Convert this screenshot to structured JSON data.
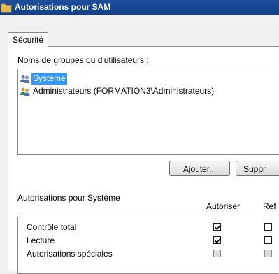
{
  "window": {
    "title": "Autorisations pour SAM",
    "icon": "folder-icon"
  },
  "tabs": [
    {
      "label": "Sécurité",
      "active": true
    }
  ],
  "groups": {
    "label": "Noms de groupes ou d'utilisateurs :",
    "items": [
      {
        "label": "Système",
        "icon": "users-icon",
        "selected": true
      },
      {
        "label": "Administrateurs (FORMATION3\\Administrateurs)",
        "icon": "users-icon",
        "selected": false
      }
    ]
  },
  "buttons": {
    "add": "Ajouter...",
    "remove": "Suppr"
  },
  "permissions": {
    "label": "Autorisations pour Système",
    "col_allow": "Autoriser",
    "col_deny": "Ref",
    "rows": [
      {
        "name": "Contrôle total",
        "allow": true,
        "deny": false,
        "allow_disabled": false,
        "deny_disabled": false
      },
      {
        "name": "Lecture",
        "allow": true,
        "deny": false,
        "allow_disabled": false,
        "deny_disabled": false
      },
      {
        "name": "Autorisations spéciales",
        "allow": false,
        "deny": false,
        "allow_disabled": true,
        "deny_disabled": true
      }
    ]
  },
  "colors": {
    "titlebar": "#0f3f8c",
    "selection": "#3399ff",
    "folder": "#e8b84a"
  }
}
